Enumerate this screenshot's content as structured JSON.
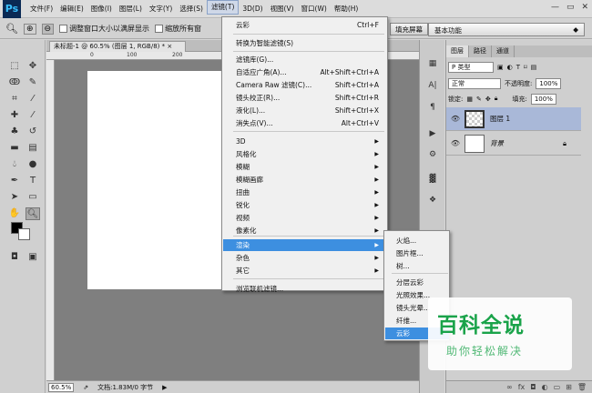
{
  "app": {
    "logo": "Ps"
  },
  "menubar": {
    "items": [
      "文件(F)",
      "编辑(E)",
      "图像(I)",
      "图层(L)",
      "文字(Y)",
      "选择(S)",
      "滤镜(T)",
      "3D(D)",
      "视图(V)",
      "窗口(W)",
      "帮助(H)"
    ],
    "active_index": 6
  },
  "options": {
    "resize_windows": "调整窗口大小以满屏显示",
    "zoom_all": "缩放所有窗",
    "fill_screen": "填充屏幕",
    "workspace": "基本功能"
  },
  "document": {
    "tab": "未标题-1 @ 60.5% (图层 1, RGB/8) *",
    "close": "×",
    "ruler_marks": [
      "0",
      "100",
      "200"
    ],
    "zoom": "60.5%",
    "doc_info": "文档:1.83M/0 字节"
  },
  "filter_menu": {
    "items": [
      {
        "label": "云彩",
        "shortcut": "Ctrl+F",
        "submenu": false
      },
      {
        "label": "转换为智能滤镜(S)",
        "shortcut": "",
        "submenu": false
      },
      {
        "label": "滤镜库(G)...",
        "shortcut": "",
        "submenu": false
      },
      {
        "label": "自适应广角(A)...",
        "shortcut": "Alt+Shift+Ctrl+A",
        "submenu": false
      },
      {
        "label": "Camera Raw 滤镜(C)...",
        "shortcut": "Shift+Ctrl+A",
        "submenu": false
      },
      {
        "label": "镜头校正(R)...",
        "shortcut": "Shift+Ctrl+R",
        "submenu": false
      },
      {
        "label": "液化(L)...",
        "shortcut": "Shift+Ctrl+X",
        "submenu": false
      },
      {
        "label": "消失点(V)...",
        "shortcut": "Alt+Ctrl+V",
        "submenu": false
      },
      {
        "label": "3D",
        "shortcut": "",
        "submenu": true
      },
      {
        "label": "风格化",
        "shortcut": "",
        "submenu": true
      },
      {
        "label": "模糊",
        "shortcut": "",
        "submenu": true
      },
      {
        "label": "模糊画廊",
        "shortcut": "",
        "submenu": true
      },
      {
        "label": "扭曲",
        "shortcut": "",
        "submenu": true
      },
      {
        "label": "锐化",
        "shortcut": "",
        "submenu": true
      },
      {
        "label": "视频",
        "shortcut": "",
        "submenu": true
      },
      {
        "label": "像素化",
        "shortcut": "",
        "submenu": true
      },
      {
        "label": "渲染",
        "shortcut": "",
        "submenu": true,
        "highlighted": true
      },
      {
        "label": "杂色",
        "shortcut": "",
        "submenu": true
      },
      {
        "label": "其它",
        "shortcut": "",
        "submenu": true
      },
      {
        "label": "浏览联机滤镜...",
        "shortcut": "",
        "submenu": false
      }
    ]
  },
  "render_submenu": {
    "items": [
      "火焰...",
      "图片框...",
      "树...",
      "分层云彩",
      "光照效果...",
      "镜头光晕...",
      "纤维...",
      "云彩"
    ],
    "highlighted_index": 7
  },
  "layers_panel": {
    "tabs": [
      "图层",
      "路径",
      "通道"
    ],
    "kind": "P 类型",
    "blend_mode": "正常",
    "opacity_label": "不透明度:",
    "opacity": "100%",
    "lock_label": "锁定:",
    "fill_label": "填充:",
    "fill": "100%",
    "layers": [
      {
        "name": "图层 1",
        "selected": true
      },
      {
        "name": "背景",
        "locked": true
      }
    ]
  },
  "watermark": {
    "title": "百科全说",
    "subtitle": "助你轻松解决"
  },
  "colors": {
    "highlight": "#3d8fe0",
    "watermark": "#1aa34a",
    "canvas_bg": "#7f7f7f"
  }
}
